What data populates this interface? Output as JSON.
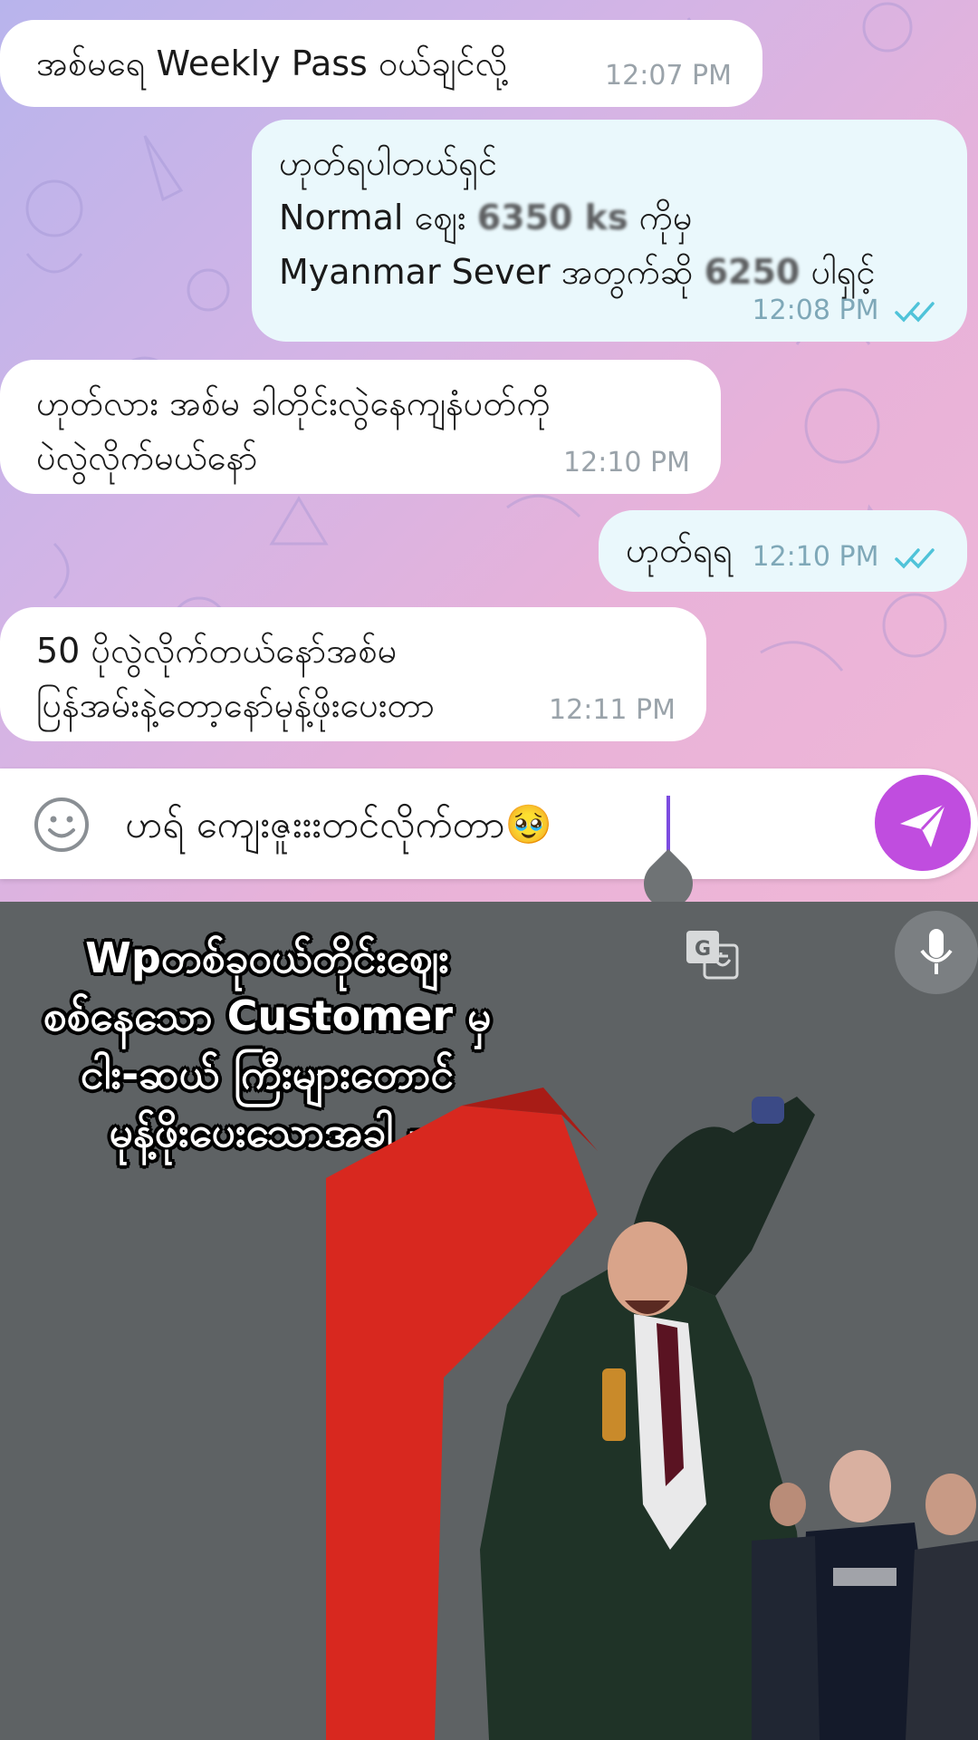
{
  "messages": [
    {
      "direction": "in",
      "text": "အစ်မရေ Weekly Pass ဝယ်ချင်လို့",
      "time": "12:07 PM"
    },
    {
      "direction": "out",
      "line1": "ဟုတ်ရပါတယ်ရှင်",
      "line2_pre": "Normal ဈေး ",
      "line2_num": "6350 ks",
      "line2_post": " ကိုမှ",
      "line3_pre": "Myanmar Sever အတွက်ဆို ",
      "line3_num": "6250",
      "line3_post": " ပါရှင့်",
      "time": "12:08 PM"
    },
    {
      "direction": "in",
      "text": "ဟုတ်လား အစ်မ ခါတိုင်းလွဲနေကျနံပတ်ကို\nပဲလွဲလိုက်မယ်နော်",
      "time": "12:10 PM"
    },
    {
      "direction": "out",
      "text": "ဟုတ်ရရ",
      "time": "12:10 PM"
    },
    {
      "direction": "in",
      "text": "50 ပိုလွဲလိုက်တယ်နော်အစ်မ\nပြန်အမ်းနဲ့တော့နော်မုန့်ဖိုးပေးတာ",
      "time": "12:11 PM"
    }
  ],
  "composer": {
    "input_value": "ဟရ် ကျေးဇူးးးတင်လိုက်တာ🥹",
    "emoji_icon": "smiley-icon",
    "send_icon": "paper-plane-icon",
    "send_color": "#c04ddf"
  },
  "keyboard": {
    "translate_icon": "translate-icon",
    "mic_icon": "microphone-icon"
  },
  "caption": {
    "line1": "Wpတစ်ခုဝယ်တိုင်းဈေး",
    "line2": "စစ်နေသော Customer မှ",
    "line3": "ငါး-ဆယ် ကြီးများတောင်",
    "line4": "မုန့်ဖိုးပေးသောအခါ -"
  },
  "colors": {
    "incoming_bubble": "#ffffff",
    "outgoing_bubble": "#eaf8fc",
    "read_check": "#4fc3d9"
  }
}
